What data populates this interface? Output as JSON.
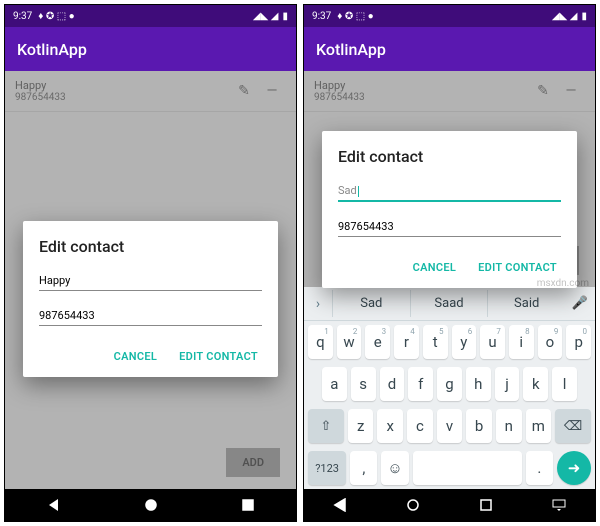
{
  "status": {
    "time": "9:37",
    "icons": "♦ ✪ ⬚ ●",
    "signal": "◢◣ ◢",
    "batt": "▮"
  },
  "app": {
    "title": "KotlinApp"
  },
  "contact": {
    "name": "Happy",
    "phone": "987654433"
  },
  "dialog": {
    "title": "Edit contact",
    "name_left": "Happy",
    "name_right": "Sad",
    "phone": "987654433",
    "cancel": "CANCEL",
    "confirm": "EDIT CONTACT"
  },
  "add_button": "ADD",
  "keyboard": {
    "suggestions": [
      "Sad",
      "Saad",
      "Said"
    ],
    "row1": [
      "q",
      "w",
      "e",
      "r",
      "t",
      "y",
      "u",
      "i",
      "o",
      "p"
    ],
    "hints1": [
      "1",
      "2",
      "3",
      "4",
      "5",
      "6",
      "7",
      "8",
      "9",
      "0"
    ],
    "row2": [
      "a",
      "s",
      "d",
      "f",
      "g",
      "h",
      "j",
      "k",
      "l"
    ],
    "row3": [
      "z",
      "x",
      "c",
      "v",
      "b",
      "n",
      "m"
    ],
    "shift": "⇧",
    "backspace": "⌫",
    "sym": "?123",
    "comma": ",",
    "emoji": "☺",
    "period": ".",
    "enter": "➜"
  },
  "watermark": "msxdn.com"
}
